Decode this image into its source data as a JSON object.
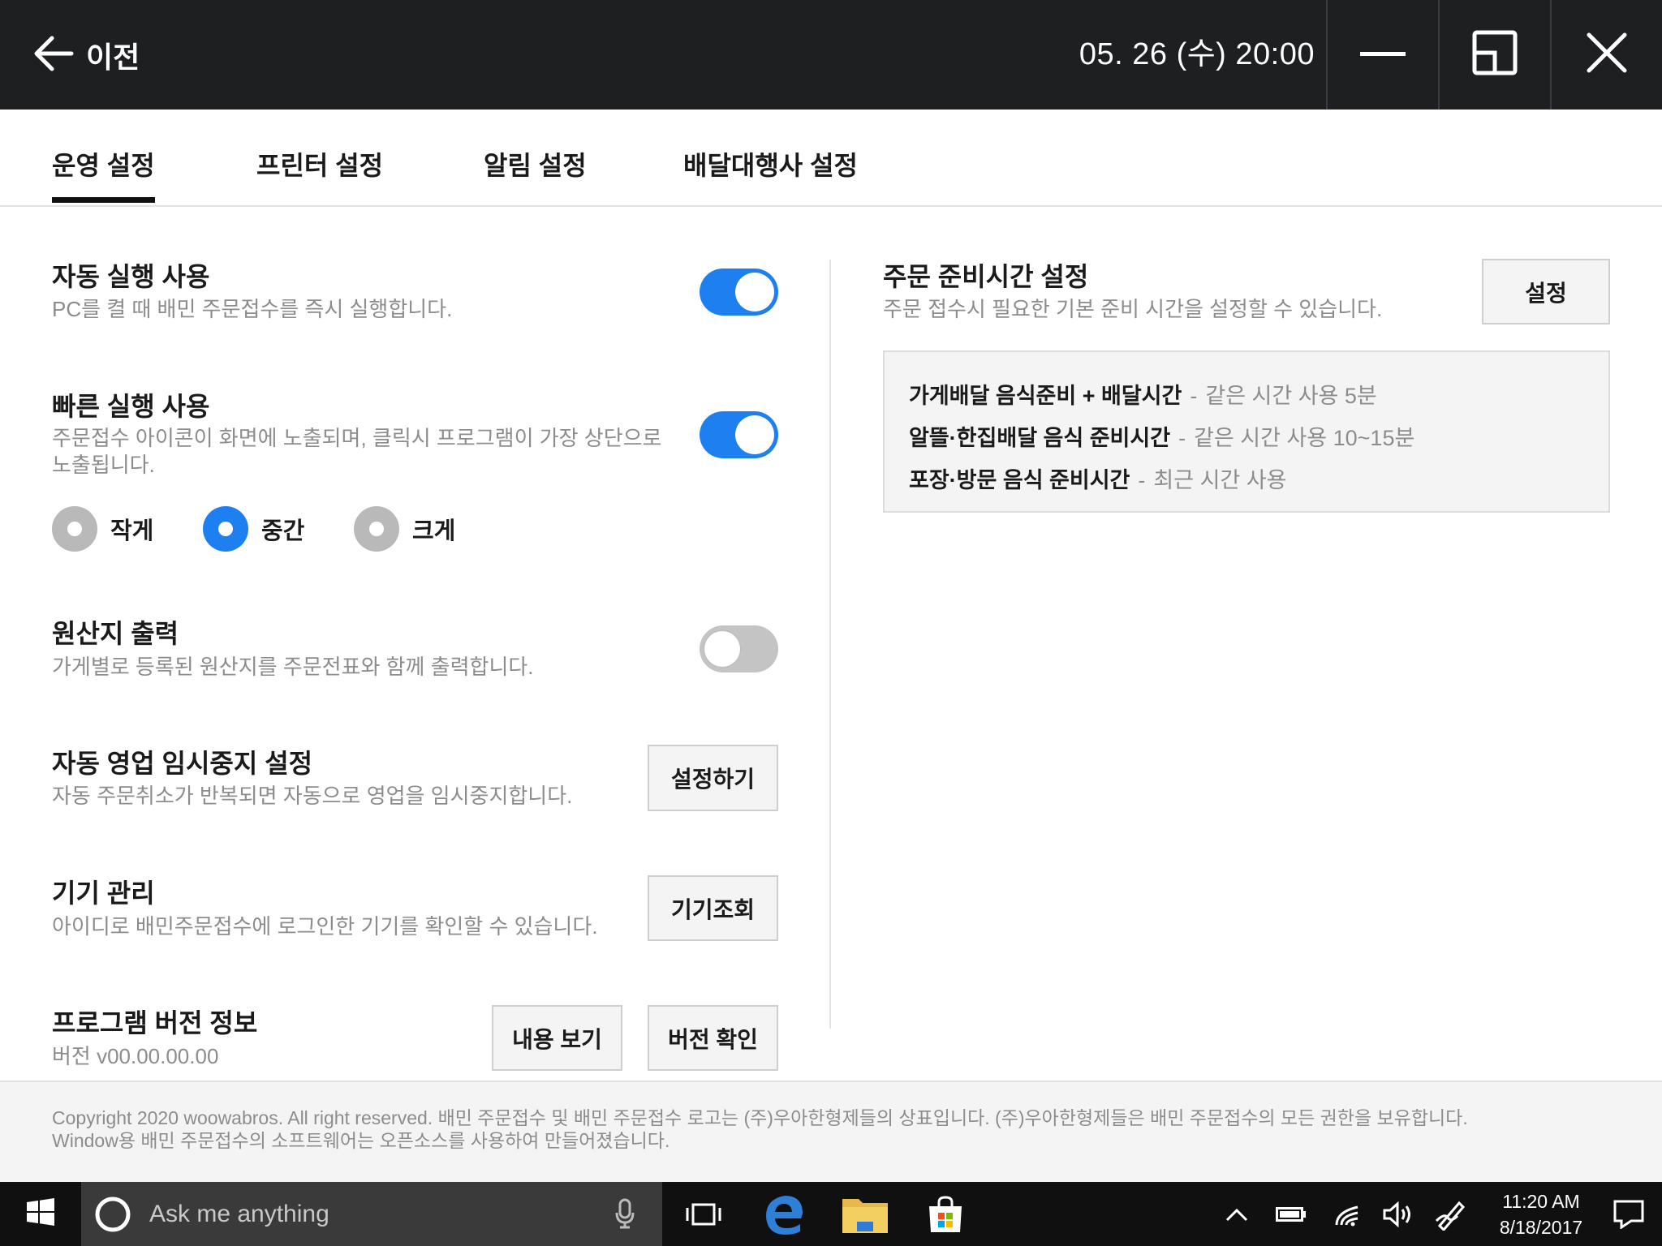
{
  "header": {
    "back_label": "이전",
    "datetime": "05. 26 (수) 20:00"
  },
  "tabs": [
    {
      "label": "운영 설정",
      "active": true
    },
    {
      "label": "프린터 설정",
      "active": false
    },
    {
      "label": "알림 설정",
      "active": false
    },
    {
      "label": "배달대행사 설정",
      "active": false
    }
  ],
  "settings": {
    "auto_run": {
      "title": "자동 실행 사용",
      "desc": "PC를 켤 때 배민 주문접수를 즉시 실행합니다.",
      "enabled": true
    },
    "quick_run": {
      "title": "빠른 실행 사용",
      "desc_line1": "주문접수 아이콘이 화면에 노출되며, 클릭시 프로그램이 가장 상단으로",
      "desc_line2": "노출됩니다.",
      "enabled": true,
      "sizes": [
        {
          "label": "작게",
          "selected": false
        },
        {
          "label": "중간",
          "selected": true
        },
        {
          "label": "크게",
          "selected": false
        }
      ]
    },
    "origin_print": {
      "title": "원산지 출력",
      "desc": "가게별로 등록된 원산지를 주문전표와 함께 출력합니다.",
      "enabled": false
    },
    "auto_pause": {
      "title": "자동 영업 임시중지 설정",
      "desc": "자동 주문취소가 반복되면 자동으로 영업을 임시중지합니다.",
      "button": "설정하기"
    },
    "device": {
      "title": "기기 관리",
      "desc": "아이디로 배민주문접수에 로그인한 기기를 확인할 수 있습니다.",
      "button": "기기조회"
    },
    "version": {
      "title": "프로그램 버전 정보",
      "desc": "버전 v00.00.00.00",
      "view_button": "내용 보기",
      "check_button": "버전 확인"
    }
  },
  "prep_time": {
    "title": "주문 준비시간 설정",
    "desc": "주문 접수시 필요한 기본 준비 시간을 설정할 수 있습니다.",
    "button": "설정",
    "rows": [
      {
        "label": "가게배달 음식준비 + 배달시간",
        "sep": "-",
        "value": "같은 시간 사용 5분"
      },
      {
        "label": "알뜰·한집배달 음식 준비시간",
        "sep": "-",
        "value": "같은 시간 사용 10~15분"
      },
      {
        "label": "포장·방문 음식 준비시간",
        "sep": "-",
        "value": "최근 시간 사용"
      }
    ]
  },
  "footer": {
    "line1": "Copyright 2020 woowabros. All right reserved. 배민 주문접수 및 배민 주문접수 로고는 (주)우아한형제들의 상표입니다. (주)우아한형제들은 배민 주문접수의 모든 권한을 보유합니다.",
    "line2": "Window용 배민 주문접수의 소프트웨어는 오픈소스를 사용하여 만들어졌습니다."
  },
  "taskbar": {
    "search_placeholder": "Ask me anything",
    "time": "11:20 AM",
    "date": "8/18/2017"
  },
  "colors": {
    "accent": "#1e7ff0",
    "topbar": "#1e1f21",
    "muted_text": "#8c8c8c"
  }
}
